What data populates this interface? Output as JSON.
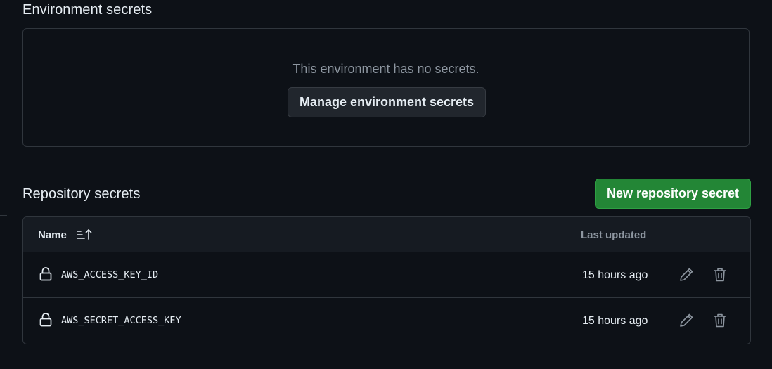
{
  "environment_secrets": {
    "title": "Environment secrets",
    "empty_message": "This environment has no secrets.",
    "manage_button": "Manage environment secrets"
  },
  "repository_secrets": {
    "title": "Repository secrets",
    "new_button": "New repository secret",
    "columns": {
      "name": "Name",
      "last_updated": "Last updated"
    },
    "rows": [
      {
        "name": "AWS_ACCESS_KEY_ID",
        "updated": "15 hours ago"
      },
      {
        "name": "AWS_SECRET_ACCESS_KEY",
        "updated": "15 hours ago"
      }
    ]
  },
  "icons": {
    "sort": "sort-ascending-icon",
    "lock": "lock-icon",
    "edit": "pencil-icon",
    "delete": "trash-icon"
  },
  "colors": {
    "background": "#0d1117",
    "border": "#30363d",
    "primary_button": "#238636",
    "muted_text": "#8d96a0"
  }
}
